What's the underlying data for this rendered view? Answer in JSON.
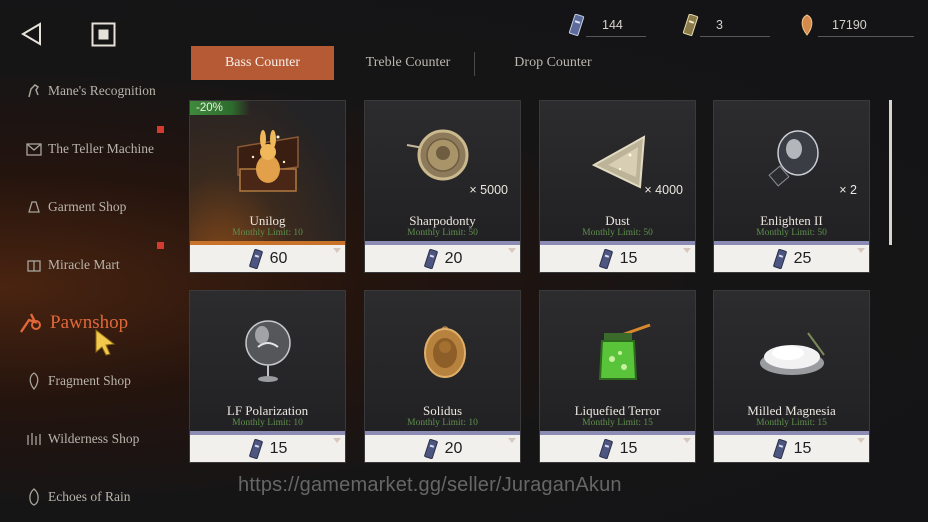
{
  "nav": {
    "back_icon": "back-triangle-icon",
    "home_icon": "square-stop-icon"
  },
  "currencies": [
    {
      "icon": "ticket-blue-icon",
      "value": "144"
    },
    {
      "icon": "ticket-gold-icon",
      "value": "3"
    },
    {
      "icon": "oric-shard-icon",
      "value": "17190"
    }
  ],
  "sidebar": {
    "items": [
      {
        "label": "Mane's Recognition",
        "icon": "horse-icon",
        "badge": false
      },
      {
        "label": "The Teller Machine",
        "icon": "teller-icon",
        "badge": true
      },
      {
        "label": "Garment Shop",
        "icon": "garment-icon",
        "badge": false
      },
      {
        "label": "Miracle Mart",
        "icon": "mart-icon",
        "badge": true
      },
      {
        "label": "Pawnshop",
        "icon": "pawnshop-icon",
        "badge": false,
        "active": true
      },
      {
        "label": "Fragment Shop",
        "icon": "fragment-icon",
        "badge": false
      },
      {
        "label": "Wilderness Shop",
        "icon": "wilderness-icon",
        "badge": false
      },
      {
        "label": "Echoes of Rain",
        "icon": "rain-icon",
        "badge": false
      }
    ]
  },
  "tabs": [
    {
      "label": "Bass Counter",
      "active": true
    },
    {
      "label": "Treble Counter",
      "active": false
    },
    {
      "label": "Drop Counter",
      "active": false
    }
  ],
  "items": [
    {
      "name": "Unilog",
      "limit": "Monthly Limit: 10",
      "price": "60",
      "quantity": "",
      "discount": "-20%",
      "strip": "#c9732a",
      "icon": "golden-rabbit-box-icon"
    },
    {
      "name": "Sharpodonty",
      "limit": "Monthly Limit: 50",
      "price": "20",
      "quantity": "× 5000",
      "discount": "",
      "strip": "#8c8bb4",
      "icon": "bronze-coin-icon"
    },
    {
      "name": "Dust",
      "limit": "Monthly Limit: 50",
      "price": "15",
      "quantity": "× 4000",
      "discount": "",
      "strip": "#8c8bb4",
      "icon": "crystal-triangle-icon"
    },
    {
      "name": "Enlighten II",
      "limit": "Monthly Limit: 50",
      "price": "25",
      "quantity": "× 2",
      "discount": "",
      "strip": "#8c8bb4",
      "icon": "light-bulb-icon"
    },
    {
      "name": "LF Polarization",
      "limit": "Monthly Limit: 10",
      "price": "15",
      "quantity": "",
      "discount": "",
      "strip": "#8c8bb4",
      "icon": "glass-globe-icon"
    },
    {
      "name": "Solidus",
      "limit": "Monthly Limit: 10",
      "price": "20",
      "quantity": "",
      "discount": "",
      "strip": "#8c8bb4",
      "icon": "gold-medallion-icon"
    },
    {
      "name": "Liquefied Terror",
      "limit": "Monthly Limit: 15",
      "price": "15",
      "quantity": "",
      "discount": "",
      "strip": "#8c8bb4",
      "icon": "green-jar-icon"
    },
    {
      "name": "Milled Magnesia",
      "limit": "Monthly Limit: 15",
      "price": "15",
      "quantity": "",
      "discount": "",
      "strip": "#8c8bb4",
      "icon": "powder-bowl-icon"
    }
  ],
  "watermark": "https://gamemarket.gg/seller/JuraganAkun",
  "colors": {
    "accent": "#b65a36",
    "active_text": "#e0683a",
    "limit_green": "#5f8f4e",
    "badge_red": "#d43a2e"
  }
}
